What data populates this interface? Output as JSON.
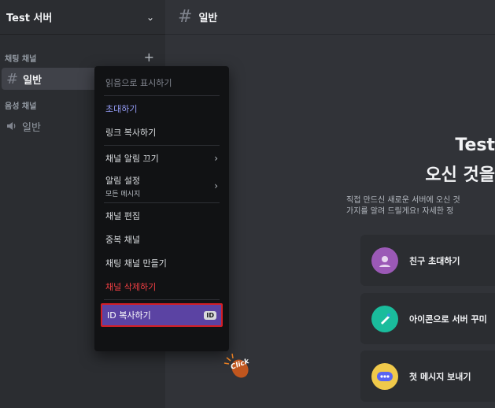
{
  "server": {
    "name": "Test 서버"
  },
  "sidebar": {
    "text_category": "채팅 채널",
    "voice_category": "음성 채널",
    "text_channel": "일반",
    "voice_channel": "일반"
  },
  "topbar": {
    "channel_name": "일반"
  },
  "welcome": {
    "title_line1": "Test",
    "title_line2": "오신 것을",
    "desc_line1": "직접 만드신 새로운 서버에 오신 것",
    "desc_line2": "가지를 알려   드릴게요! 자세한 정"
  },
  "cards": [
    {
      "label": "친구 초대하기",
      "icon": "invite-friends-icon",
      "color": "#9b59b6"
    },
    {
      "label": "아이콘으로 서버 꾸미",
      "icon": "brush-icon",
      "color": "#1abc9c"
    },
    {
      "label": "첫 메시지 보내기",
      "icon": "message-bubble-icon",
      "color": "#f0c94a"
    }
  ],
  "context_menu": {
    "mark_read": "읽음으로 표시하기",
    "invite": "초대하기",
    "copy_link": "링크 복사하기",
    "mute_channel": "채널 알림 끄기",
    "notif_settings": "알림 설정",
    "notif_settings_sub": "모든 메시지",
    "edit_channel": "채널 편집",
    "duplicate_channel": "중복 채널",
    "create_text_channel": "채팅 채널 만들기",
    "delete_channel": "채널 삭제하기",
    "copy_id": "ID 복사하기",
    "id_badge": "ID"
  },
  "cursor": {
    "label": "Click"
  },
  "colors": {
    "accent": "#949cf7",
    "danger": "#f23f43",
    "highlight": "#5b43a3",
    "outline": "#d41f26"
  }
}
